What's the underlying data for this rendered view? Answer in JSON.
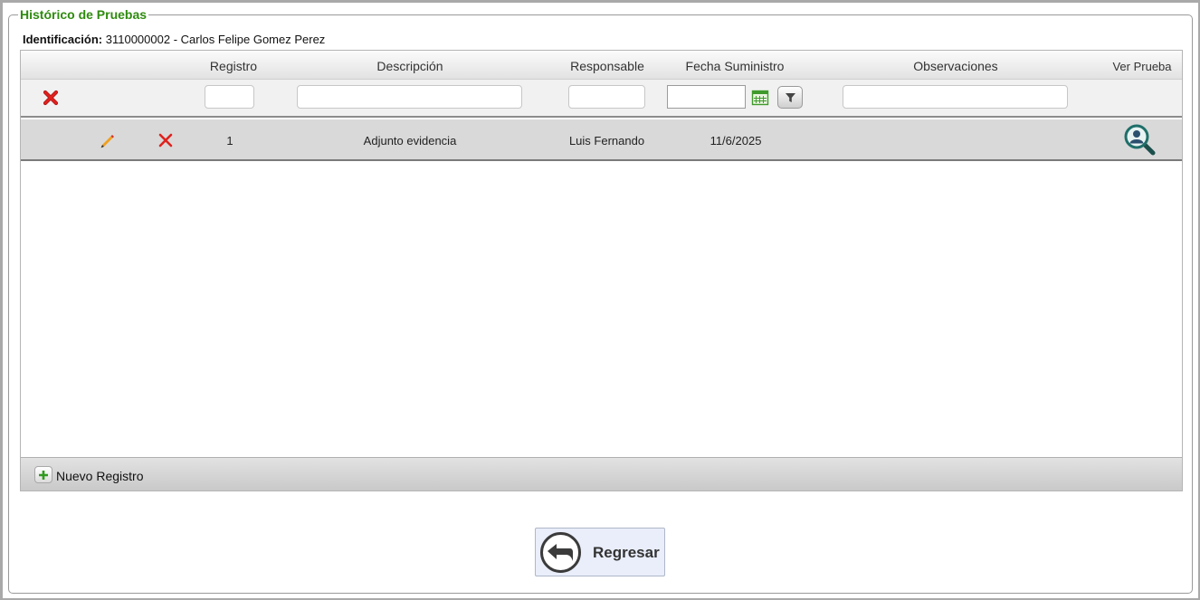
{
  "panel": {
    "title": "Histórico de Pruebas",
    "identification_label": "Identificación:",
    "identification_value": "3110000002 - Carlos Felipe Gomez Perez"
  },
  "grid": {
    "columns": {
      "registro": "Registro",
      "descripcion": "Descripción",
      "responsable": "Responsable",
      "fecha": "Fecha Suministro",
      "observaciones": "Observaciones",
      "ver_prueba": "Ver Prueba"
    },
    "filters": {
      "registro": "",
      "descripcion": "",
      "responsable": "",
      "fecha": "",
      "observaciones": ""
    },
    "rows": [
      {
        "registro": "1",
        "descripcion": "Adjunto evidencia",
        "responsable": "Luis Fernando",
        "fecha": "11/6/2025",
        "observaciones": ""
      }
    ],
    "footer_add_label": "Nuevo Registro"
  },
  "actions": {
    "back_label": "Regresar"
  },
  "icons": {
    "clear_filters": "clear-filter-icon",
    "calendar": "calendar-icon",
    "filter": "filter-icon",
    "edit": "pencil-icon",
    "delete": "delete-icon",
    "view": "magnifier-user-icon",
    "add": "plus-icon",
    "back": "back-arrow-icon"
  },
  "colors": {
    "title_green": "#2e8b0e",
    "delete_red": "#e0211d",
    "view_teal": "#1f6f6a"
  }
}
